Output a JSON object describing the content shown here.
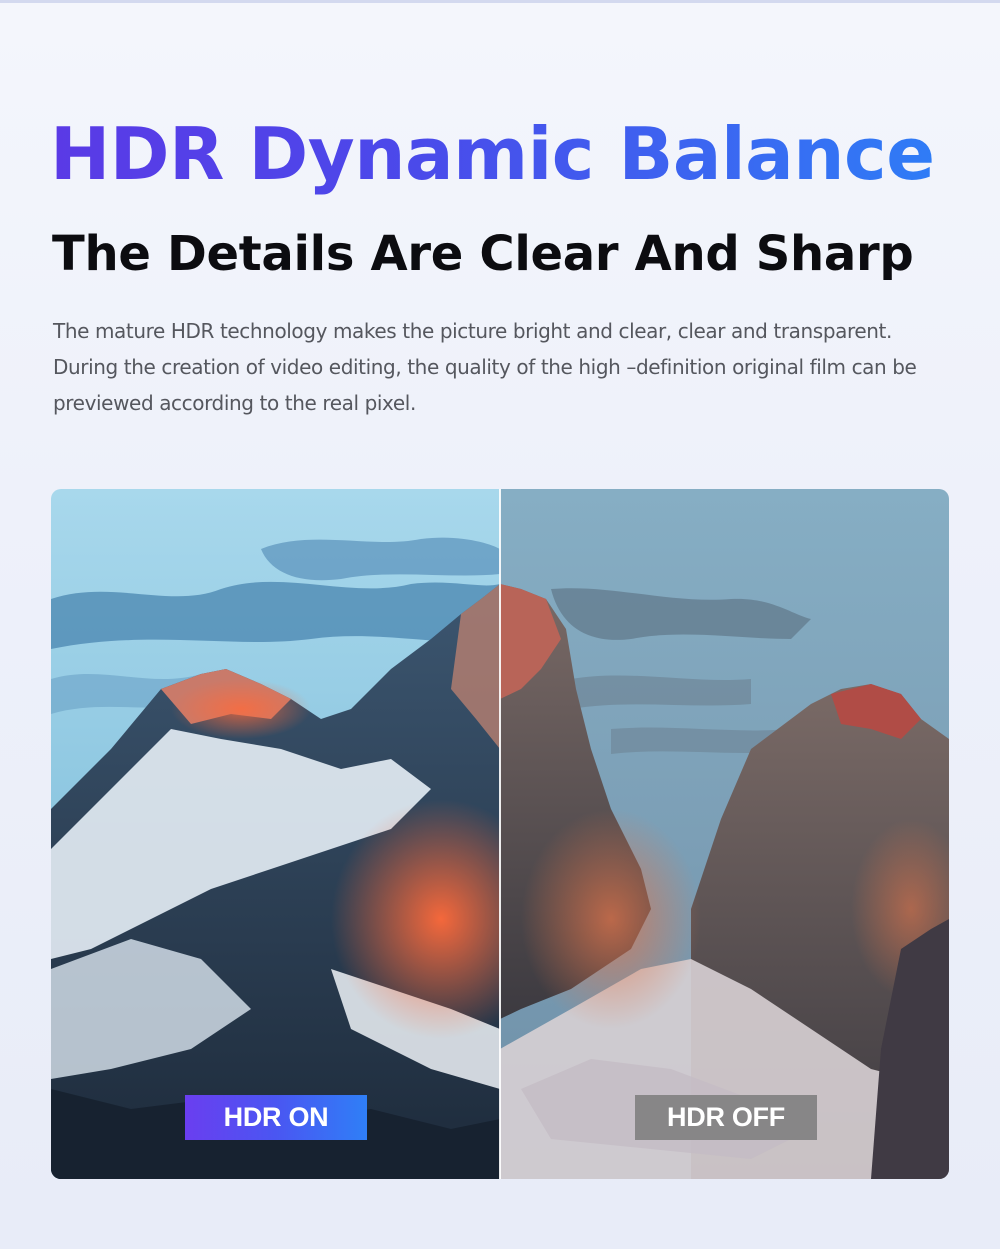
{
  "header": {
    "headline": "HDR Dynamic Balance",
    "subheadline": "The Details Are Clear And Sharp",
    "description": "The mature HDR technology makes the picture bright and clear, clear and transparent. During the creation of video editing, the quality of the high –definition original film can be previewed according to the real pixel."
  },
  "comparison": {
    "left_label": "HDR ON",
    "right_label": "HDR OFF",
    "colors": {
      "hdr_on_badge_start": "#6a3ef0",
      "hdr_on_badge_end": "#2f7ff7",
      "hdr_off_badge": "#808080",
      "headline_gradient_start": "#5a3ae6",
      "headline_gradient_end": "#2f7cf6"
    }
  }
}
